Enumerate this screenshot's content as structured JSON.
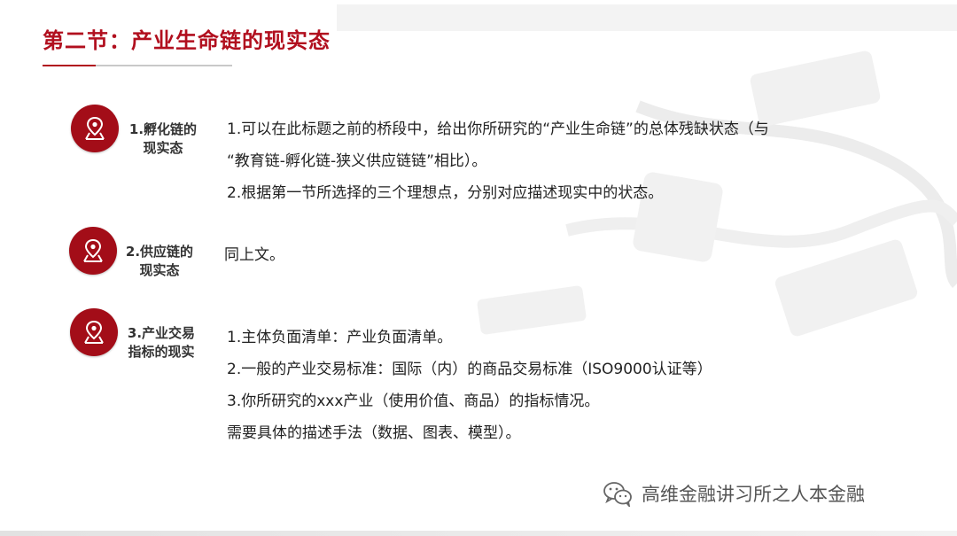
{
  "slide": {
    "title": "第二节：产业生命链的现实态"
  },
  "sections": [
    {
      "label_line1": "1.孵化链的",
      "label_line2": "现实态",
      "icon": "location-pin-icon",
      "lines": [
        "1.可以在此标题之前的桥段中，给出你所研究的“产业生命链”的总体残缺状态（与",
        "“教育链-孵化链-狭义供应链链”相比）。",
        "2.根据第一节所选择的三个理想点，分别对应描述现实中的状态。"
      ]
    },
    {
      "label_line1": "2.供应链的",
      "label_line2": "现实态",
      "icon": "location-pin-icon",
      "lines": [
        "同上文。"
      ]
    },
    {
      "label_line1": "3.产业交易",
      "label_line2": "指标的现实",
      "icon": "location-pin-icon",
      "lines": [
        "1.主体负面清单：产业负面清单。",
        "2.一般的产业交易标准：国际（内）的商品交易标准（ISO9000认证等）",
        "3.你所研究的xxx产业（使用价值、商品）的指标情况。",
        "需要具体的描述手法（数据、图表、模型）。"
      ]
    }
  ],
  "watermark": {
    "text": "高维金融讲习所之人本金融",
    "icon": "wechat-icon"
  },
  "colors": {
    "accent": "#b10f1e",
    "badge": "#a30d18"
  }
}
